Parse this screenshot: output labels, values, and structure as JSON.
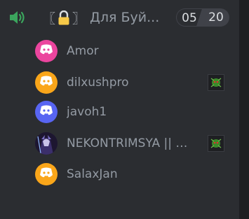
{
  "channel": {
    "bracket_open": "〖",
    "bracket_close": "〗",
    "name": "Для Буй...",
    "user_count": "05",
    "user_limit": "20"
  },
  "users": [
    {
      "name": "Amor",
      "avatar_color": "#eb459e",
      "avatar_icon": "discord-logo-icon",
      "has_status_icon": false
    },
    {
      "name": "dilxushpro",
      "avatar_color": "#faa61a",
      "avatar_icon": "discord-logo-icon",
      "has_status_icon": true
    },
    {
      "name": "javoh1",
      "avatar_color": "#5865f2",
      "avatar_icon": "discord-logo-icon",
      "has_status_icon": false
    },
    {
      "name": "NEKONTRIMSYA || Q...",
      "avatar_color": "#2a2040",
      "avatar_icon": "anime-avatar-icon",
      "has_status_icon": true
    },
    {
      "name": "SalaxJan",
      "avatar_color": "#faa61a",
      "avatar_icon": "discord-logo-icon",
      "has_status_icon": false
    }
  ],
  "colors": {
    "background": "#2b2d31",
    "speaker_green": "#3ba55d",
    "text_muted": "#949ba4",
    "lock_yellow": "#f7c948"
  }
}
